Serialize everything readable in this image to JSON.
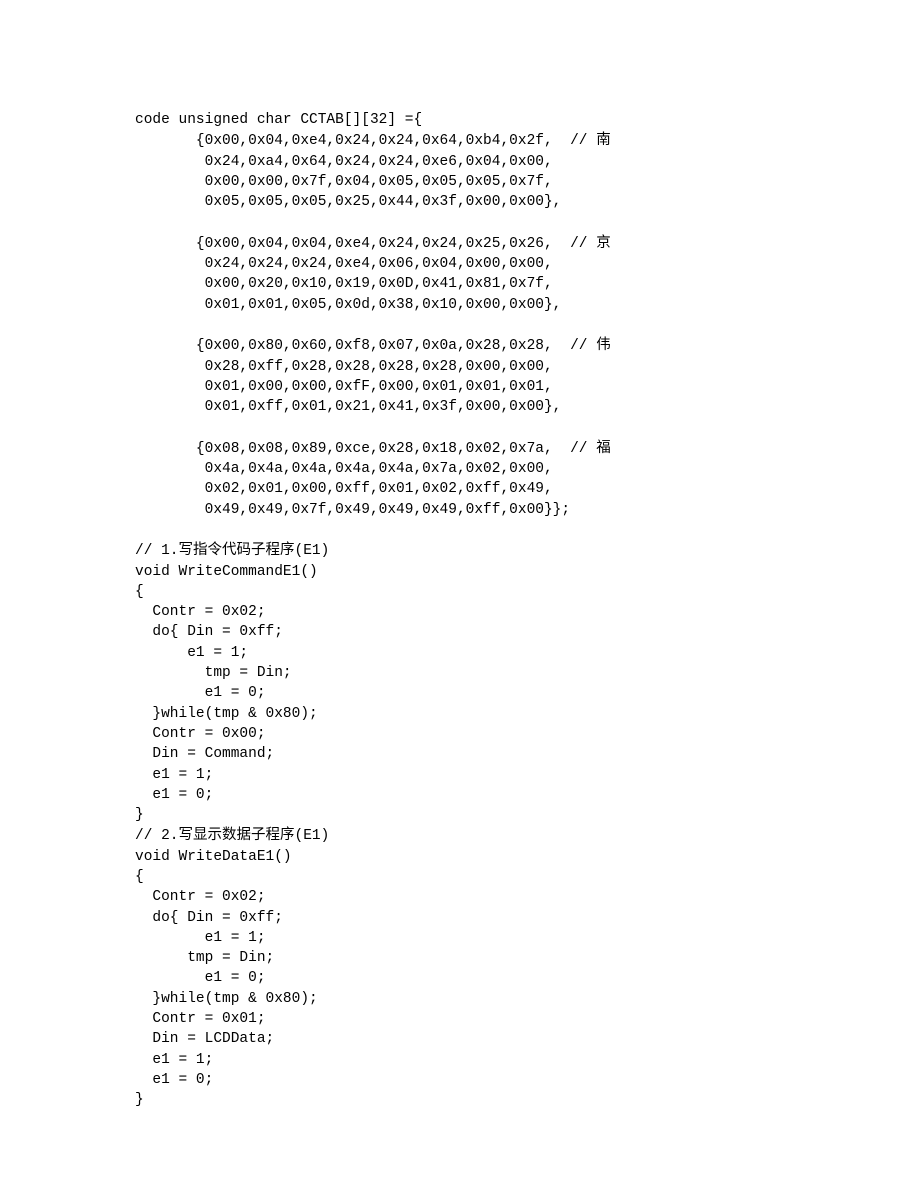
{
  "code": {
    "l01": "code unsigned char CCTAB[][32] ={",
    "l02": "       {0x00,0x04,0xe4,0x24,0x24,0x64,0xb4,0x2f,  // ",
    "c02": "南",
    "l03": "        0x24,0xa4,0x64,0x24,0x24,0xe6,0x04,0x00,",
    "l04": "        0x00,0x00,0x7f,0x04,0x05,0x05,0x05,0x7f,",
    "l05": "        0x05,0x05,0x05,0x25,0x44,0x3f,0x00,0x00},",
    "l06": "",
    "l07": "       {0x00,0x04,0x04,0xe4,0x24,0x24,0x25,0x26,  // ",
    "c07": "京",
    "l08": "        0x24,0x24,0x24,0xe4,0x06,0x04,0x00,0x00,",
    "l09": "        0x00,0x20,0x10,0x19,0x0D,0x41,0x81,0x7f,",
    "l10": "        0x01,0x01,0x05,0x0d,0x38,0x10,0x00,0x00},",
    "l11": "",
    "l12": "       {0x00,0x80,0x60,0xf8,0x07,0x0a,0x28,0x28,  // ",
    "c12": "伟",
    "l13": "        0x28,0xff,0x28,0x28,0x28,0x28,0x00,0x00,",
    "l14": "        0x01,0x00,0x00,0xfF,0x00,0x01,0x01,0x01,",
    "l15": "        0x01,0xff,0x01,0x21,0x41,0x3f,0x00,0x00},",
    "l16": "",
    "l17": "       {0x08,0x08,0x89,0xce,0x28,0x18,0x02,0x7a,  // ",
    "c17": "福",
    "l18": "        0x4a,0x4a,0x4a,0x4a,0x4a,0x7a,0x02,0x00,",
    "l19": "        0x02,0x01,0x00,0xff,0x01,0x02,0xff,0x49,",
    "l20": "        0x49,0x49,0x7f,0x49,0x49,0x49,0xff,0x00}};",
    "l21": "",
    "l22a": "// 1.",
    "l22b": "写指令代码子程序",
    "l22c": "(E1)",
    "l23": "void WriteCommandE1()",
    "l24": "{",
    "l25": "  Contr = 0x02;",
    "l26": "  do{ Din = 0xff;",
    "l27": "      e1 = 1;",
    "l28": "        tmp = Din;",
    "l29": "        e1 = 0;",
    "l30": "  }while(tmp & 0x80);",
    "l31": "  Contr = 0x00;",
    "l32": "  Din = Command;",
    "l33": "  e1 = 1;",
    "l34": "  e1 = 0;",
    "l35": "}",
    "l36a": "// 2.",
    "l36b": "写显示数据子程序",
    "l36c": "(E1)",
    "l37": "void WriteDataE1()",
    "l38": "{",
    "l39": "  Contr = 0x02;",
    "l40": "  do{ Din = 0xff;",
    "l41": "        e1 = 1;",
    "l42": "      tmp = Din;",
    "l43": "        e1 = 0;",
    "l44": "  }while(tmp & 0x80);",
    "l45": "  Contr = 0x01;",
    "l46": "  Din = LCDData;",
    "l47": "  e1 = 1;",
    "l48": "  e1 = 0;",
    "l49": "}"
  }
}
